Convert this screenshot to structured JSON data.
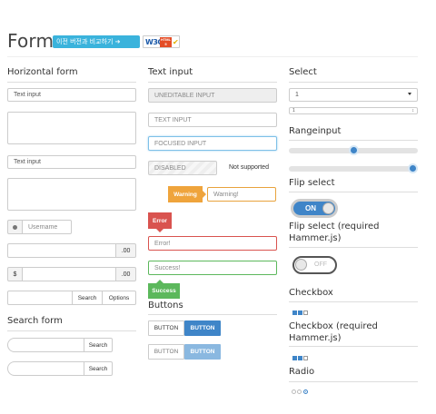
{
  "header": {
    "title": "Form",
    "compare_label": "이전 버전과 비교하기 ➔",
    "w3c_label": "W3C",
    "html5_label": "HTML 5"
  },
  "horizontal_form": {
    "title": "Horizontal form",
    "text_input_1": "Text input",
    "text_input_2": "Text input",
    "username_placeholder": "Username",
    "amount_suffix_1": ".00",
    "currency_prefix": "$",
    "amount_suffix_2": ".00",
    "search_button": "Search",
    "options_button": "Options"
  },
  "search_form": {
    "title": "Search form",
    "search_button_1": "Search",
    "search_button_2": "Search"
  },
  "text_input": {
    "title": "Text input",
    "uneditable": "UNEDITABLE INPUT",
    "text_input": "TEXT INPUT",
    "focused": "FOCUSED INPUT",
    "disabled": "DISABLED",
    "not_supported": "Not supported",
    "warning_tag": "Warning",
    "warning_value": "Warning!",
    "error_tag": "Error",
    "error_value": "Error!",
    "success_value": "Success!",
    "success_tag": "Success"
  },
  "buttons": {
    "title": "Buttons",
    "row1": [
      "BUTTON",
      "BUTTON"
    ],
    "row2": [
      "BUTTON",
      "BUTTON"
    ]
  },
  "select": {
    "title": "Select",
    "value_1": "1",
    "value_2": "1"
  },
  "rangeinput": {
    "title": "Rangeinput",
    "value_1": 0.5,
    "value_2": 1.0
  },
  "flip_select": {
    "title": "Flip select",
    "on_label": "ON",
    "title_hammer": "Flip select (required Hammer.js)",
    "off_label": "OFF"
  },
  "checkbox": {
    "title": "Checkbox",
    "title_hammer": "Checkbox (required Hammer.js)"
  },
  "radio": {
    "title": "Radio"
  },
  "colors": {
    "accent": "#3f85c8",
    "error": "#d9534f",
    "success": "#5cb85c",
    "warning": "#efa43c",
    "badge": "#3ab3dc"
  }
}
